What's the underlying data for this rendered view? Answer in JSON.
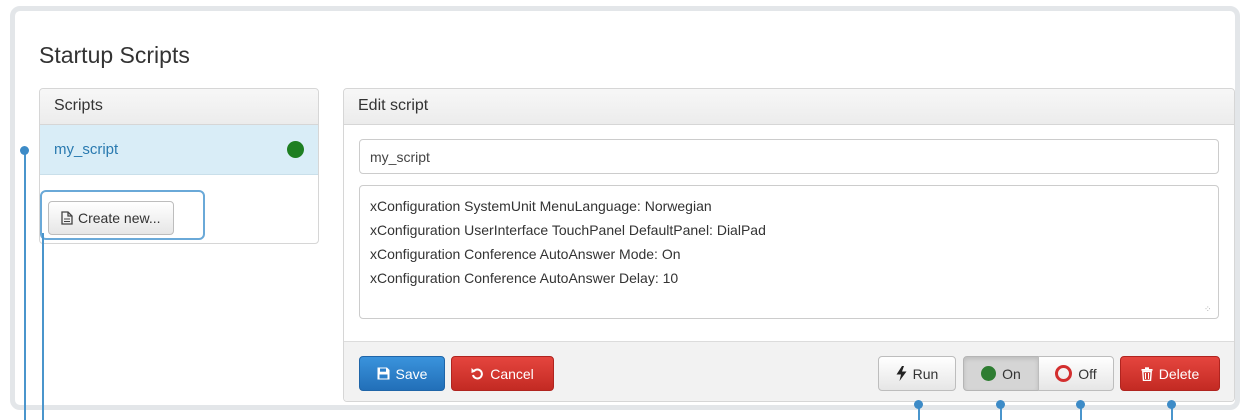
{
  "page": {
    "title": "Startup Scripts"
  },
  "scripts_panel": {
    "heading": "Scripts",
    "items": [
      {
        "name": "my_script",
        "status": "on"
      }
    ],
    "create_button": "Create new..."
  },
  "editor": {
    "heading": "Edit script",
    "script_name": "my_script",
    "code": "xConfiguration SystemUnit MenuLanguage: Norwegian\nxConfiguration UserInterface TouchPanel DefaultPanel: DialPad\nxConfiguration Conference AutoAnswer Mode: On\nxConfiguration Conference AutoAnswer Delay: 10"
  },
  "buttons": {
    "save": "Save",
    "cancel": "Cancel",
    "run": "Run",
    "on": "On",
    "off": "Off",
    "delete": "Delete"
  },
  "colors": {
    "primary": "#2a7fcb",
    "danger": "#d0312b",
    "active_status": "#1e7f22",
    "callout": "#4a95cc"
  }
}
